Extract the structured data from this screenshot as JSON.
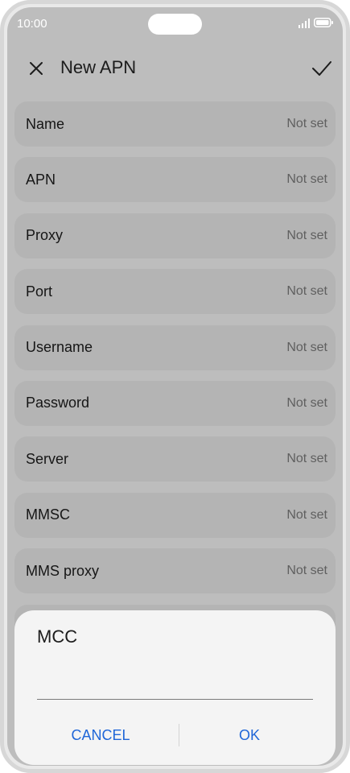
{
  "status_bar": {
    "time": "10:00"
  },
  "header": {
    "title": "New APN",
    "close_icon": "close-icon",
    "confirm_icon": "check-icon"
  },
  "settings": [
    {
      "label": "Name",
      "value": "Not set"
    },
    {
      "label": "APN",
      "value": "Not set"
    },
    {
      "label": "Proxy",
      "value": "Not set"
    },
    {
      "label": "Port",
      "value": "Not set"
    },
    {
      "label": "Username",
      "value": "Not set"
    },
    {
      "label": "Password",
      "value": "Not set"
    },
    {
      "label": "Server",
      "value": "Not set"
    },
    {
      "label": "MMSC",
      "value": "Not set"
    },
    {
      "label": "MMS proxy",
      "value": "Not set"
    }
  ],
  "dialog": {
    "title": "MCC",
    "input_value": "",
    "cancel_label": "CANCEL",
    "ok_label": "OK"
  },
  "colors": {
    "accent": "#1f66d8",
    "scrim": "#bdbdbd",
    "dialog_bg": "#f4f4f4"
  }
}
